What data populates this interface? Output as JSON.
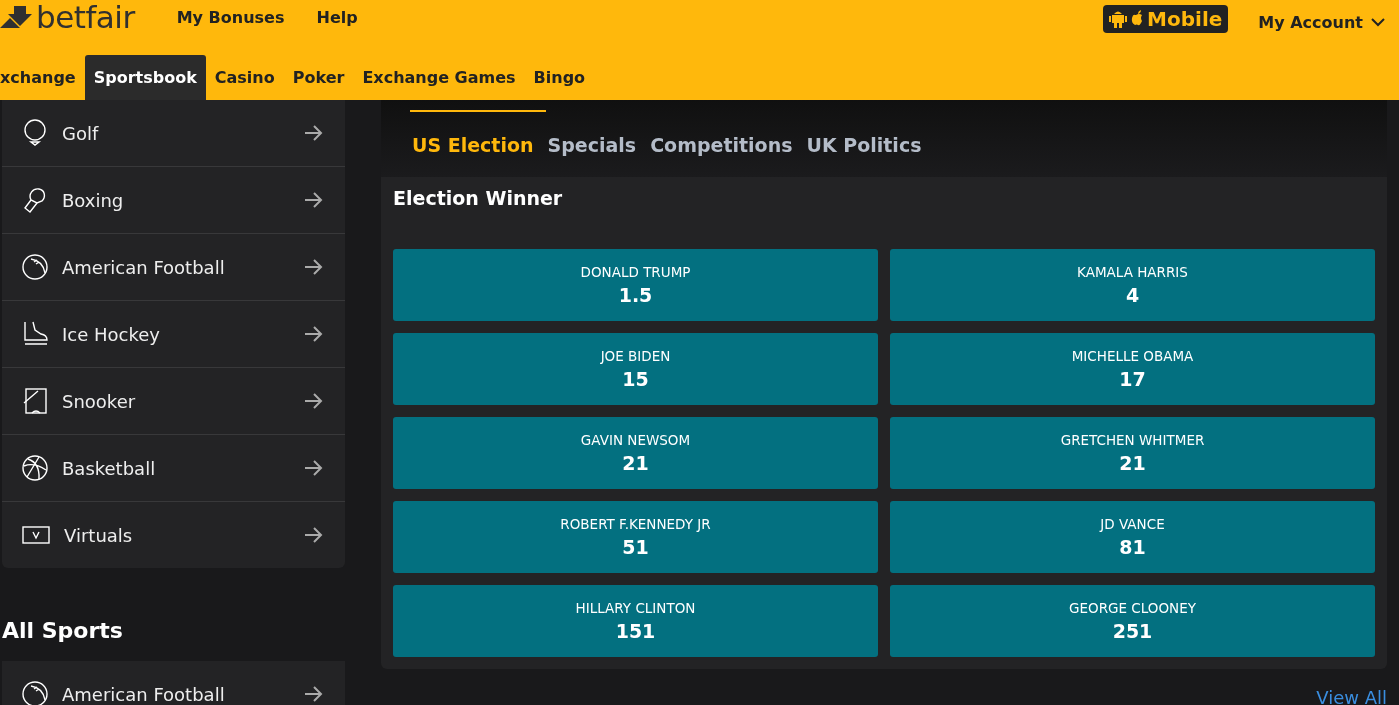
{
  "header": {
    "logo": "betfair",
    "links": [
      "My Bonuses",
      "Help"
    ],
    "mobile_badge": "Mobile",
    "account": "My Account"
  },
  "nav": [
    {
      "label": "xchange",
      "selected": false
    },
    {
      "label": "Sportsbook",
      "selected": true
    },
    {
      "label": "Casino",
      "selected": false
    },
    {
      "label": "Poker",
      "selected": false
    },
    {
      "label": "Exchange Games",
      "selected": false
    },
    {
      "label": "Bingo",
      "selected": false
    }
  ],
  "sidebar": {
    "items": [
      {
        "label": "Golf",
        "kind": "golf"
      },
      {
        "label": "Boxing",
        "kind": "boxing"
      },
      {
        "label": "American Football",
        "kind": "football"
      },
      {
        "label": "Ice Hockey",
        "kind": "skate"
      },
      {
        "label": "Snooker",
        "kind": "snooker"
      },
      {
        "label": "Basketball",
        "kind": "basketball"
      },
      {
        "label": "Virtuals",
        "kind": "virtuals"
      }
    ],
    "all_sports_title": "All Sports",
    "all_sports": [
      {
        "label": "American Football",
        "kind": "football"
      }
    ]
  },
  "tabs": [
    {
      "label": "US Election",
      "selected": true
    },
    {
      "label": "Specials",
      "selected": false
    },
    {
      "label": "Competitions",
      "selected": false
    },
    {
      "label": "UK Politics",
      "selected": false
    }
  ],
  "market": {
    "title": "Election Winner",
    "selections": [
      {
        "name": "DONALD TRUMP",
        "odds": "1.5"
      },
      {
        "name": "KAMALA HARRIS",
        "odds": "4"
      },
      {
        "name": "JOE BIDEN",
        "odds": "15"
      },
      {
        "name": "MICHELLE OBAMA",
        "odds": "17"
      },
      {
        "name": "GAVIN NEWSOM",
        "odds": "21"
      },
      {
        "name": "GRETCHEN WHITMER",
        "odds": "21"
      },
      {
        "name": "ROBERT F.KENNEDY JR",
        "odds": "51"
      },
      {
        "name": "JD VANCE",
        "odds": "81"
      },
      {
        "name": "HILLARY CLINTON",
        "odds": "151"
      },
      {
        "name": "GEORGE CLOONEY",
        "odds": "251"
      }
    ]
  },
  "view_all": "View All"
}
